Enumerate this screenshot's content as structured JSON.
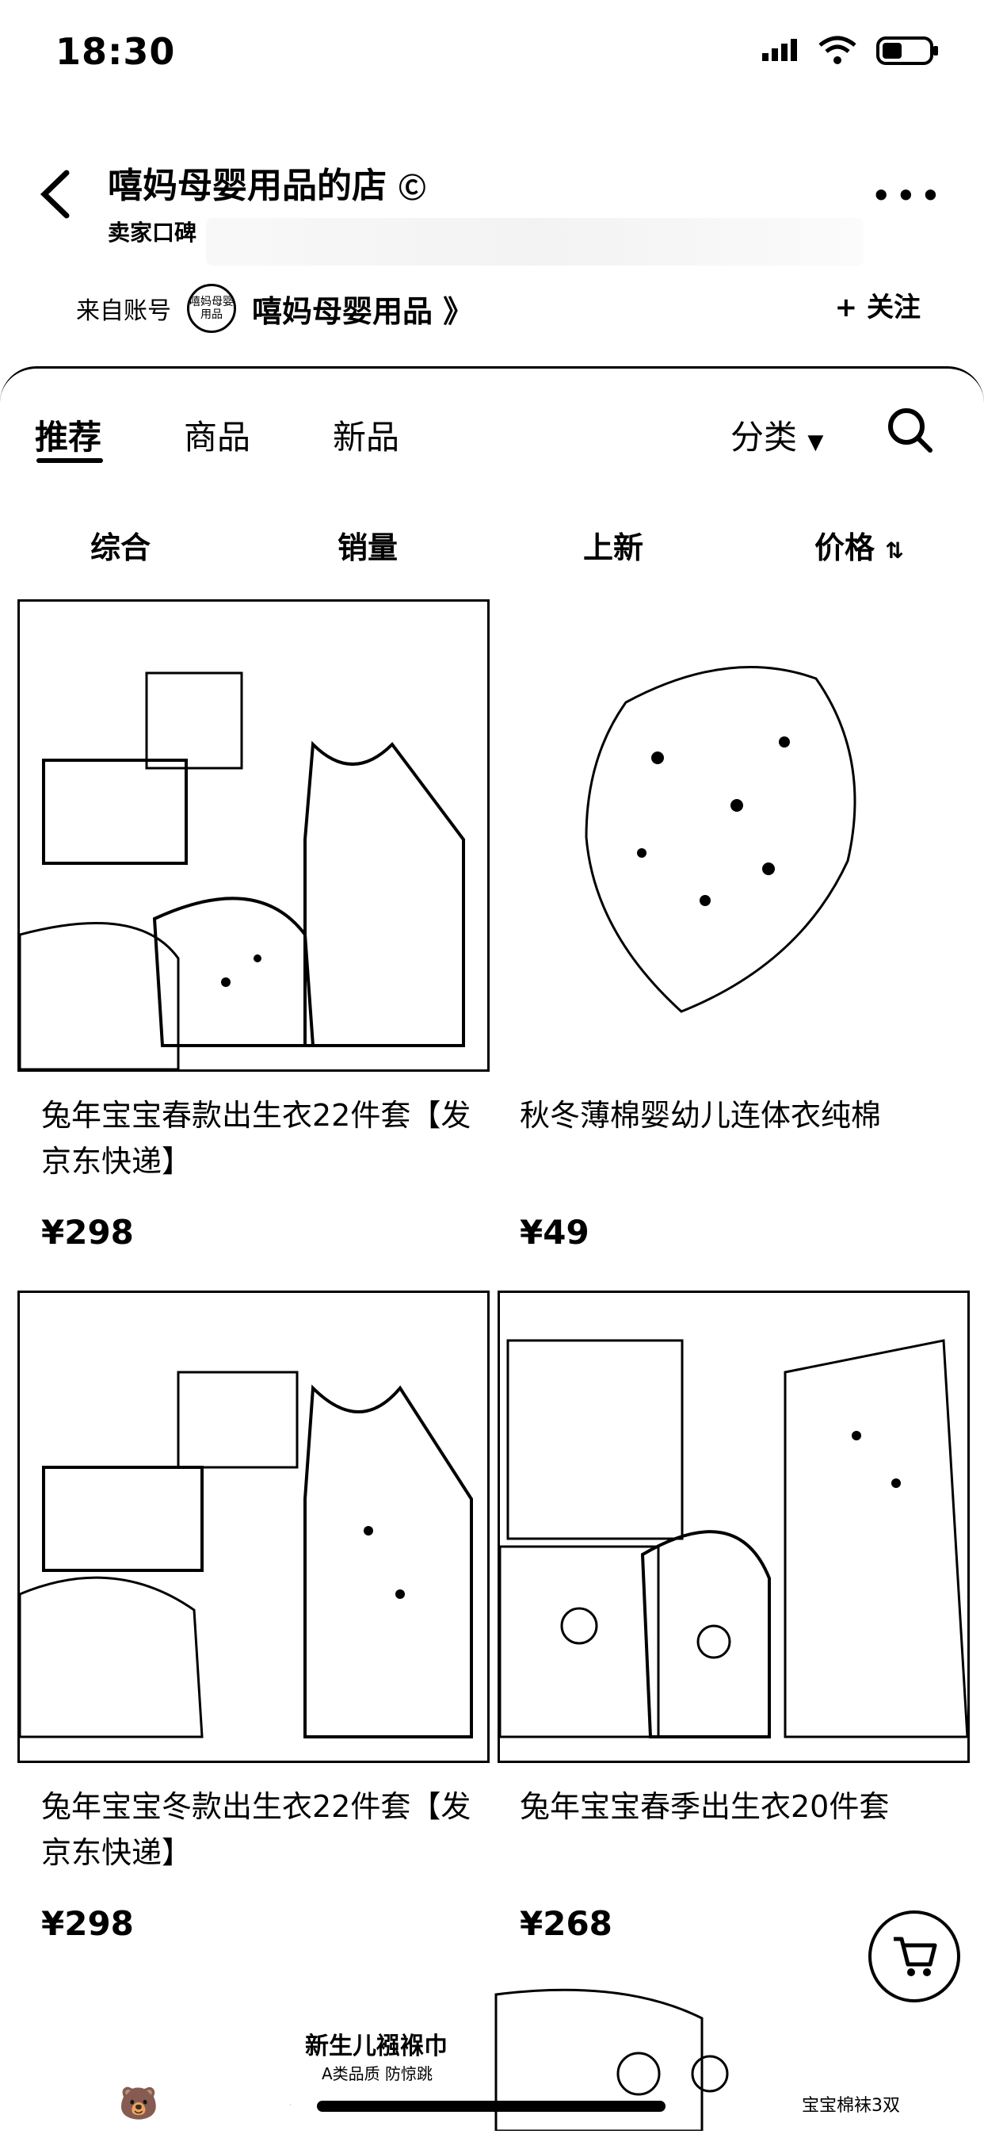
{
  "status": {
    "time": "18:30"
  },
  "header": {
    "shop_name": "嘻妈母婴用品的店",
    "seller_reputation": "卖家口碑",
    "from_label": "来自账号",
    "brand_badge": "嘻妈母婴用品",
    "brand_link": "嘻妈母婴用品 》",
    "follow": "+ 关注"
  },
  "tabs": [
    {
      "label": "推荐"
    },
    {
      "label": "商品"
    },
    {
      "label": "新品"
    }
  ],
  "category": "分类",
  "sort": {
    "overall": "综合",
    "sales": "销量",
    "new": "上新",
    "price": "价格"
  },
  "products": [
    {
      "title": "兔年宝宝春款出生衣22件套【发京东快递】",
      "price": "¥298"
    },
    {
      "title": "秋冬薄棉婴幼儿连体衣纯棉",
      "price": "¥49"
    },
    {
      "title": "兔年宝宝冬款出生衣22件套【发京东快递】",
      "price": "¥298"
    },
    {
      "title": "兔年宝宝春季出生衣20件套",
      "price": "¥268"
    }
  ],
  "banner": {
    "title": "新生儿襁褓巾",
    "subtitle": "A类品质 防惊跳",
    "tag": "宝宝棉袜3双"
  }
}
